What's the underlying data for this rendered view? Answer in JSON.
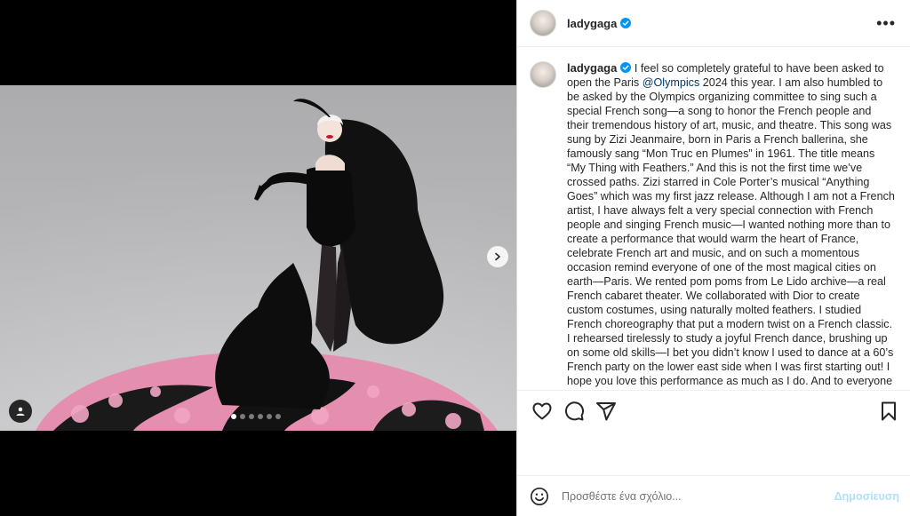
{
  "post": {
    "username": "ladygaga",
    "caption_pre": "I feel so completely grateful to have been asked to open the Paris ",
    "caption_mention": "@Olympics",
    "caption_post": " 2024 this year. I am also humbled to be asked by the Olympics organizing committee to sing such a special French song—a song to honor the French people and their tremendous history of art, music, and theatre. This song was sung by Zizi Jeanmaire, born in Paris a French ballerina, she famously sang “Mon Truc en Plumes” in 1961. The title means “My Thing with Feathers.” And this is not the first time we’ve crossed paths. Zizi starred in Cole Porter’s musical “Anything Goes” which was my first jazz release. Although I am not a French artist, I have always felt a very special connection with French people and singing French music—I wanted nothing more than to create a performance that would warm the heart of France, celebrate French art and music, and on such a momentous occasion remind everyone of one of the most magical cities on earth—Paris. We rented pom poms from Le Lido archive—a real French cabaret theater. We collaborated with Dior to create custom costumes, using naturally molted feathers. I studied French choreography that put a modern twist on a French classic. I rehearsed tirelessly to study a joyful French dance, brushing up on some old skills—I bet you didn’t know I used to dance at a 60’s French party on the lower east side when I was first starting out! I hope you love this performance as much as I do. And to everyone in France, thank you so much for welcoming us to"
  },
  "carousel": {
    "total": 6,
    "active_index": 0
  },
  "icons": {
    "header": [
      "verified-icon",
      "more-options-icon"
    ],
    "media": [
      "chevron-right-icon",
      "user-tag-icon"
    ],
    "actions": [
      "heart-icon",
      "comment-icon",
      "share-icon",
      "bookmark-icon"
    ],
    "comment": [
      "emoji-icon"
    ]
  },
  "comment_box": {
    "placeholder": "Προσθέστε ένα σχόλιο...",
    "post_label": "Δημοσίευση"
  },
  "colors": {
    "verified": "#0095f6",
    "link": "#00376b",
    "post_disabled": "#b2dffc",
    "feather_pink": "#e58fb0",
    "dress": "#0d0d0d"
  }
}
